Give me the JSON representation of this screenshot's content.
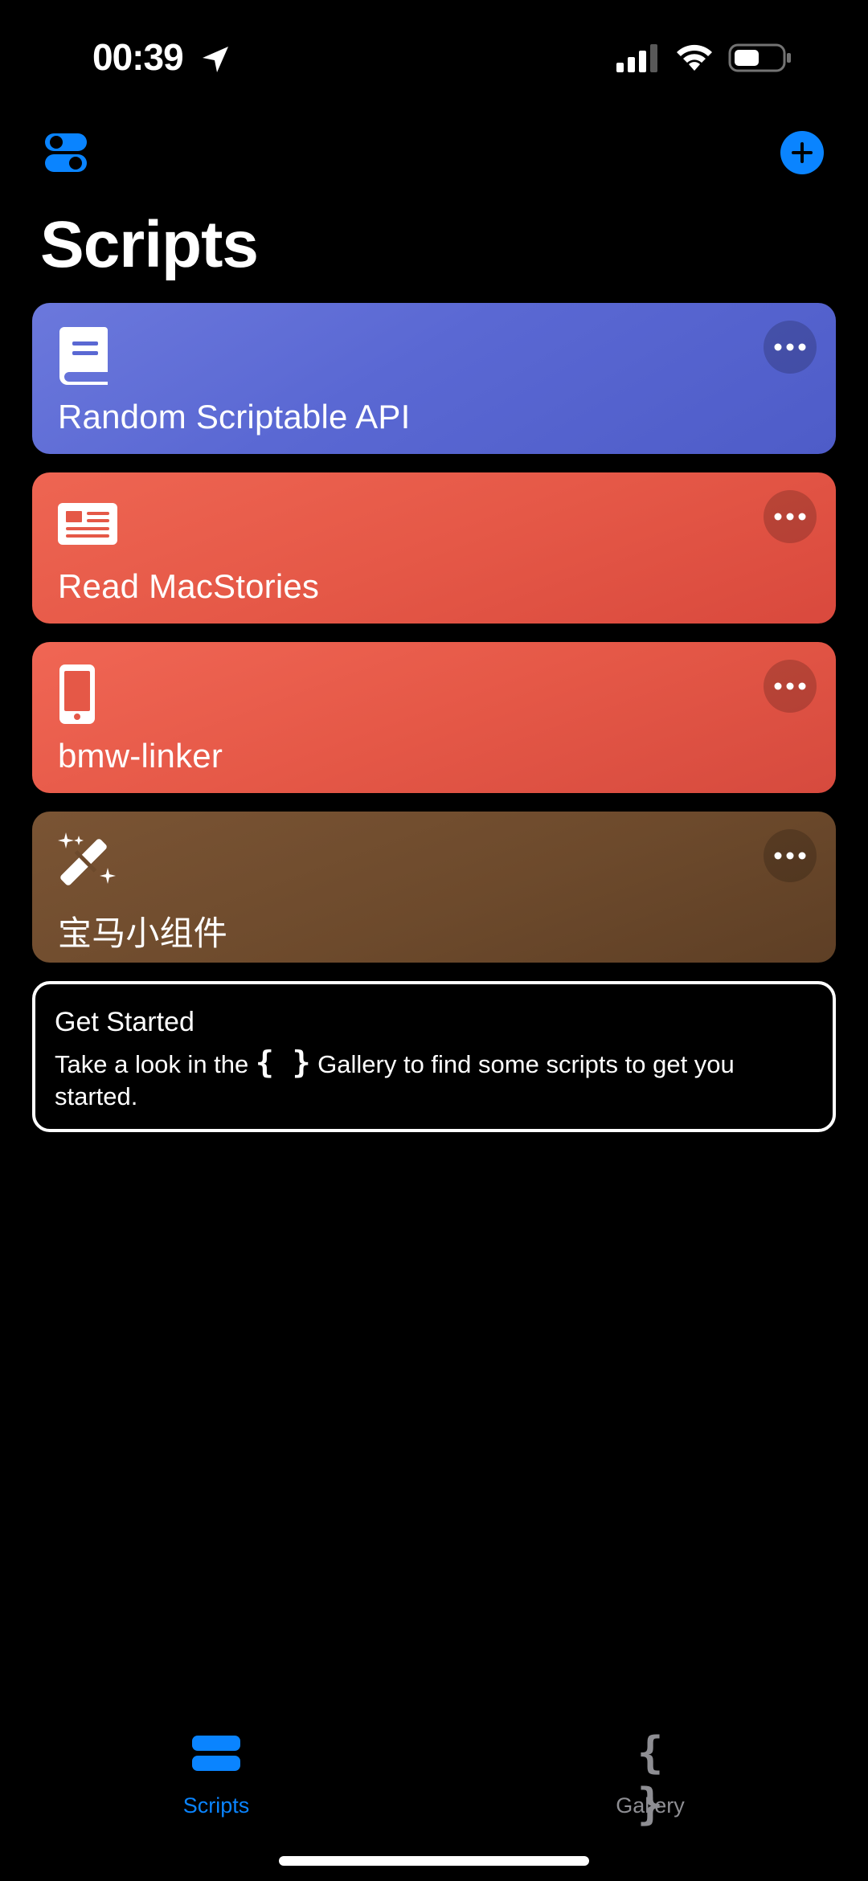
{
  "status_bar": {
    "time": "00:39"
  },
  "header": {
    "title": "Scripts"
  },
  "scripts": [
    {
      "name": "Random Scriptable API",
      "icon": "book-icon",
      "color": "#5a68d3"
    },
    {
      "name": "Read MacStories",
      "icon": "newspaper-icon",
      "color": "#e55847"
    },
    {
      "name": "bmw-linker",
      "icon": "phone-icon",
      "color": "#e55847"
    },
    {
      "name": "宝马小组件",
      "icon": "magic-wand-icon",
      "color": "#6d4a2c"
    }
  ],
  "get_started": {
    "title": "Get Started",
    "text_before": "Take a look in the",
    "brace": "{ }",
    "text_after": "Gallery to find some scripts to get you started."
  },
  "tab_bar": {
    "scripts_label": "Scripts",
    "gallery_label": "Gallery",
    "gallery_brace": "{ }",
    "active": "Scripts",
    "active_color": "#0a84ff"
  }
}
